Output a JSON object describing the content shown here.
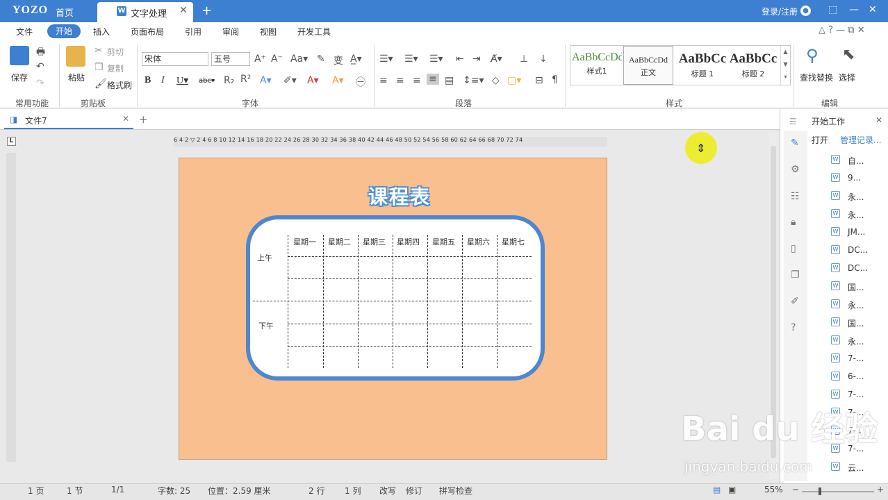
{
  "titlebar": {
    "logo": "YOZO",
    "home_label": "首页",
    "active_tab": "文字处理",
    "tab_icon": "W",
    "login": "登录/注册"
  },
  "menu": [
    "文件",
    "开始",
    "插入",
    "页面布局",
    "引用",
    "审阅",
    "视图",
    "开发工具"
  ],
  "active_menu": "开始",
  "ribbon": {
    "save": "保存",
    "paste": "粘贴",
    "cut": "剪切",
    "copy": "复制",
    "format_painter": "格式刷",
    "group_common": "常用功能",
    "group_clipboard": "剪贴板",
    "font_name": "宋体",
    "font_size": "五号",
    "group_font": "字体",
    "group_paragraph": "段落",
    "group_styles": "样式",
    "group_edit": "编辑",
    "find_replace": "查找替换",
    "select": "选择",
    "styles": [
      {
        "sample": "AaBbCcDd",
        "name": "样式1"
      },
      {
        "sample": "AaBbCcDd",
        "name": "正文"
      },
      {
        "sample": "AaBbCc",
        "name": "标题 1"
      },
      {
        "sample": "AaBbCc",
        "name": "标题 2"
      }
    ]
  },
  "file_tab": "文件7",
  "ruler_text": "6  4  2  ▽  2  4  6  8  10  12  14  16  18  20  22  24  26  28  30  32  34  36  38  40  42  44  46  48  50  52  54  56  58  60  62  64  66  68  70  72  74",
  "document": {
    "title": "课程表",
    "days": [
      "星期一",
      "星期二",
      "星期三",
      "星期四",
      "星期五",
      "星期六",
      "星期七"
    ],
    "morning": "上午",
    "afternoon": "下午"
  },
  "sidebar": {
    "title": "开始工作",
    "open": "打开",
    "manage": "管理记录...",
    "files": [
      "自...",
      "9...",
      "永...",
      "永...",
      "JM...",
      "DC...",
      "DC...",
      "国...",
      "永...",
      "国...",
      "永...",
      "7-...",
      "6-...",
      "7-...",
      "7-...",
      "7-...",
      "7-...",
      "云..."
    ]
  },
  "status": {
    "page": "1 页",
    "section": "1 节",
    "pages": "1/1",
    "words": "字数: 25",
    "position": "位置：2.59 厘米",
    "row": "2 行",
    "col": "1 列",
    "overwrite": "改写",
    "revise": "修订",
    "spell": "拼写检查",
    "zoom": "55%"
  },
  "watermark": {
    "brand": "Bai du 经验",
    "url": "jingyan.baidu.com"
  }
}
